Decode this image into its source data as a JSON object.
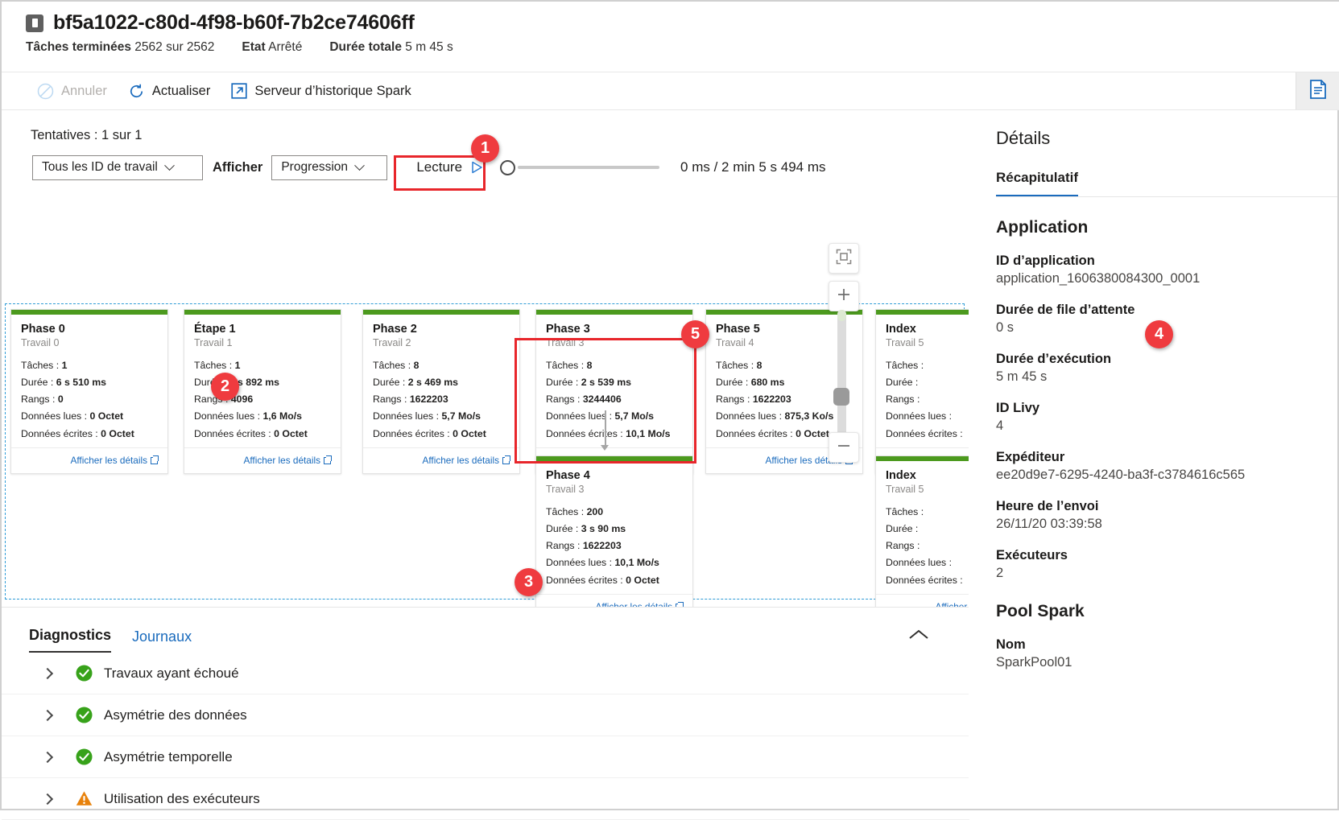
{
  "header": {
    "title": "bf5a1022-c80d-4f98-b60f-7b2ce74606ff",
    "stats": [
      {
        "key": "Tâches terminées",
        "value": "2562 sur 2562"
      },
      {
        "key": "Etat",
        "value": "Arrêté"
      },
      {
        "key": "Durée totale",
        "value": "5 m 45 s"
      }
    ]
  },
  "commandbar": {
    "cancel": "Annuler",
    "refresh": "Actualiser",
    "spark_history": "Serveur d’historique Spark"
  },
  "controls": {
    "attempts": "Tentatives : 1 sur 1",
    "job_filter": "Tous les ID de travail",
    "afficher_label": "Afficher",
    "view_mode": "Progression",
    "play_label": "Lecture",
    "time": "0 ms / 2 min 5 s 494 ms"
  },
  "graph": {
    "details_link": "Afficher les détails",
    "labels": {
      "tasks": "Tâches :",
      "duration": "Durée :",
      "rows": "Rangs :",
      "read": "Données lues :",
      "written": "Données écrites :"
    },
    "cards": [
      {
        "title": "Phase 0",
        "job": "Travail 0",
        "tasks": "1",
        "duration": "6 s 510 ms",
        "rows": "0",
        "read": "0 Octet",
        "written": "0 Octet"
      },
      {
        "title": "Étape 1",
        "job": "Travail 1",
        "tasks": "1",
        "duration": "6 s 892 ms",
        "rows": "4096",
        "read": "1,6 Mo/s",
        "written": "0 Octet"
      },
      {
        "title": "Phase 2",
        "job": "Travail 2",
        "tasks": "8",
        "duration": "2 s 469 ms",
        "rows": "1622203",
        "read": "5,7 Mo/s",
        "written": "0 Octet"
      },
      {
        "title": "Phase 3",
        "job": "Travail 3",
        "tasks": "8",
        "duration": "2 s 539 ms",
        "rows": "3244406",
        "read": "5,7 Mo/s",
        "written": "10,1 Mo/s"
      },
      {
        "title": "Phase 5",
        "job": "Travail 4",
        "tasks": "8",
        "duration": "680 ms",
        "rows": "1622203",
        "read": "875,3 Ko/s",
        "written": "0 Octet"
      },
      {
        "title": "Index",
        "job": "Travail 5",
        "tasks": "",
        "duration": "",
        "rows": "",
        "read": "",
        "written": ""
      }
    ],
    "card_phase4": {
      "title": "Phase 4",
      "job": "Travail 3",
      "tasks": "200",
      "duration": "3 s 90 ms",
      "rows": "1622203",
      "read": "10,1 Mo/s",
      "written": "0 Octet"
    },
    "card_index2": {
      "title": "Index",
      "job": "Travail 5",
      "tasks": "",
      "duration": "",
      "rows": "",
      "read": "",
      "written": ""
    }
  },
  "diagnostics": {
    "tabs": [
      {
        "label": "Diagnostics",
        "active": true
      },
      {
        "label": "Journaux",
        "active": false
      }
    ],
    "rows": [
      {
        "label": "Travaux ayant échoué",
        "status": "ok"
      },
      {
        "label": "Asymétrie des données",
        "status": "ok"
      },
      {
        "label": "Asymétrie temporelle",
        "status": "ok"
      },
      {
        "label": "Utilisation des exécuteurs",
        "status": "warning"
      }
    ]
  },
  "details": {
    "title": "Détails",
    "tab": "Récapitulatif",
    "section_application": "Application",
    "section_pool": "Pool Spark",
    "fields": [
      {
        "key": "ID d’application",
        "value": "application_1606380084300_0001"
      },
      {
        "key": "Durée de file d’attente",
        "value": "0 s"
      },
      {
        "key": "Durée d’exécution",
        "value": "5 m 45 s"
      },
      {
        "key": "ID Livy",
        "value": "4"
      },
      {
        "key": "Expéditeur",
        "value": "ee20d9e7-6295-4240-ba3f-c3784616c565"
      },
      {
        "key": "Heure de l’envoi",
        "value": "26/11/20 03:39:58"
      },
      {
        "key": "Exécuteurs",
        "value": "2"
      }
    ],
    "pool_fields": [
      {
        "key": "Nom",
        "value": "SparkPool01"
      }
    ]
  },
  "annotations": [
    {
      "number": "1"
    },
    {
      "number": "2"
    },
    {
      "number": "3"
    },
    {
      "number": "4"
    },
    {
      "number": "5"
    }
  ],
  "colors": {
    "accent": "#1a6bbd",
    "stage_bar_green": "#4c9a1e",
    "callout_red": "#ef3b3f",
    "status_ok": "#37a21a",
    "status_warn": "#e8820c"
  }
}
